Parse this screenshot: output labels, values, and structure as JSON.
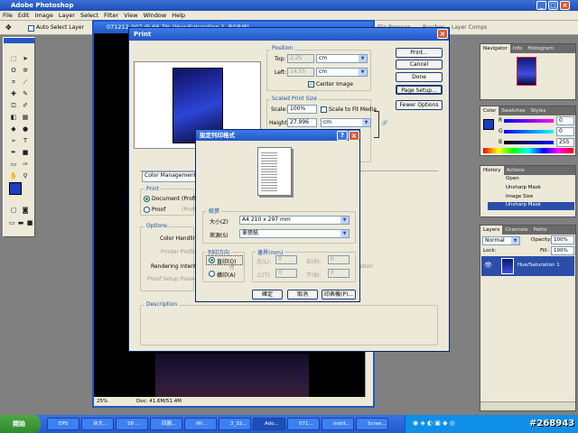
{
  "app": {
    "title": "Adobe Photoshop",
    "menu": [
      "File",
      "Edit",
      "Image",
      "Layer",
      "Select",
      "Filter",
      "View",
      "Window",
      "Help"
    ],
    "options": {
      "auto_select_label": "Auto Select Layer",
      "tab_file_browser": "File Browser",
      "tab_brushes": "Brushes",
      "tab_layer_comps": "Layer Comps"
    }
  },
  "document": {
    "title": "071212-007 @ 66.7% (Hue/Saturation 1, RGB/8)",
    "zoom": "25%",
    "doc_info": "Doc: 41.6M/51.4M"
  },
  "print_dialog": {
    "title": "Print",
    "position": {
      "label": "Position",
      "top_label": "Top:",
      "top_value": "2.25",
      "top_unit": "cm",
      "left_label": "Left:",
      "left_value": "14.55",
      "left_unit": "cm",
      "center_image": "Center Image"
    },
    "scaled": {
      "label": "Scaled Print Size",
      "scale_label": "Scale:",
      "scale_value": "100%",
      "scale_to_fit": "Scale to Fit Media",
      "height_label": "Height:",
      "height_value": "27.996",
      "height_unit": "cm"
    },
    "buttons": {
      "print": "Print...",
      "cancel": "Cancel",
      "done": "Done",
      "page_setup": "Page Setup...",
      "fewer_options": "Fewer Options"
    },
    "color_management": "Color Management",
    "print_group": {
      "label": "Print",
      "document": "Document",
      "document_suffix": "(Profile",
      "proof": "Proof",
      "proof_suffix": "(Profile"
    },
    "options_group": {
      "label": "Options",
      "color_handling": "Color Handling:",
      "printer_profile": "Printer Profile:",
      "rendering_intent": "Rendering Intent:",
      "proof_setup": "Proof Setup Preset:",
      "dim_right": "ation"
    },
    "description": "Description"
  },
  "setup_dialog": {
    "title": "設定列印格式",
    "paper_group": "紙張",
    "size_label": "大小(Z)",
    "size_value": "A4 210 x 297 mm",
    "source_label": "來源(S)",
    "source_value": "單張紙",
    "orient_group": "列印方向",
    "portrait": "直印(O)",
    "landscape": "橫印(A)",
    "margin_group": "邊界(mm)",
    "margin_left": "左(L):",
    "margin_right": "右(R):",
    "margin_top": "上(T):",
    "margin_bottom": "下(B):",
    "margin_val": "0",
    "ok": "確定",
    "cancel": "取消",
    "printer": "印表機(P)..."
  },
  "panels": {
    "navigator_tabs": [
      "Navigator",
      "Info",
      "Histogram"
    ],
    "color_tabs": [
      "Color",
      "Swatches",
      "Styles"
    ],
    "color_channels": [
      {
        "name": "R",
        "value": "0"
      },
      {
        "name": "G",
        "value": "0"
      },
      {
        "name": "B",
        "value": "255"
      }
    ],
    "history_tabs": [
      "History",
      "Actions"
    ],
    "history_items": [
      "Open",
      "Unsharp Mask",
      "Image Size",
      "Unsharp Mask"
    ],
    "layers_tabs": [
      "Layers",
      "Channels",
      "Paths"
    ],
    "blend_mode": "Normal",
    "opacity_label": "Opacity:",
    "opacity_value": "100%",
    "lock_label": "Lock:",
    "fill_label": "Fill:",
    "fill_value": "100%",
    "layer_name": "Hue/Saturation 1"
  },
  "taskbar": {
    "start": "開始",
    "tasks": [
      "EPS",
      "台大...",
      "58 ...",
      "四圖...",
      "Wi...",
      "3_32...",
      "Ado...",
      "071...",
      "Instit...",
      "Scree..."
    ],
    "counter": "#268943"
  },
  "colors": {
    "accent": "#2456c8",
    "foreground_swatch": "#1d3fbf",
    "selection": "#2b4fa8"
  }
}
